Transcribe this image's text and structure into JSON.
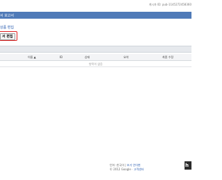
{
  "publisher": {
    "id_text": "게시자 ID: pub-1145272458360"
  },
  "header": {
    "title": "서 보고서"
  },
  "section": {
    "link_text": "상품 편집"
  },
  "actions": {
    "highlighted_button": "서 편집"
  },
  "table": {
    "columns": [
      "이름 ▲",
      "ID",
      "상태",
      "요약",
      "최종 수정"
    ],
    "empty_message": "항목이 없음"
  },
  "footer": {
    "line1_prefix": "언어: ",
    "language": "한국어",
    "language_sep": " | ",
    "language_link": "보기 언어변",
    "line2_prefix": "© 2012 Google · ",
    "google_link": "고객센터"
  },
  "badge": {
    "text": "h"
  },
  "colors": {
    "title_bar": "#4f7ab8",
    "highlight": "#dd1d1d",
    "link": "#2a5db0"
  }
}
